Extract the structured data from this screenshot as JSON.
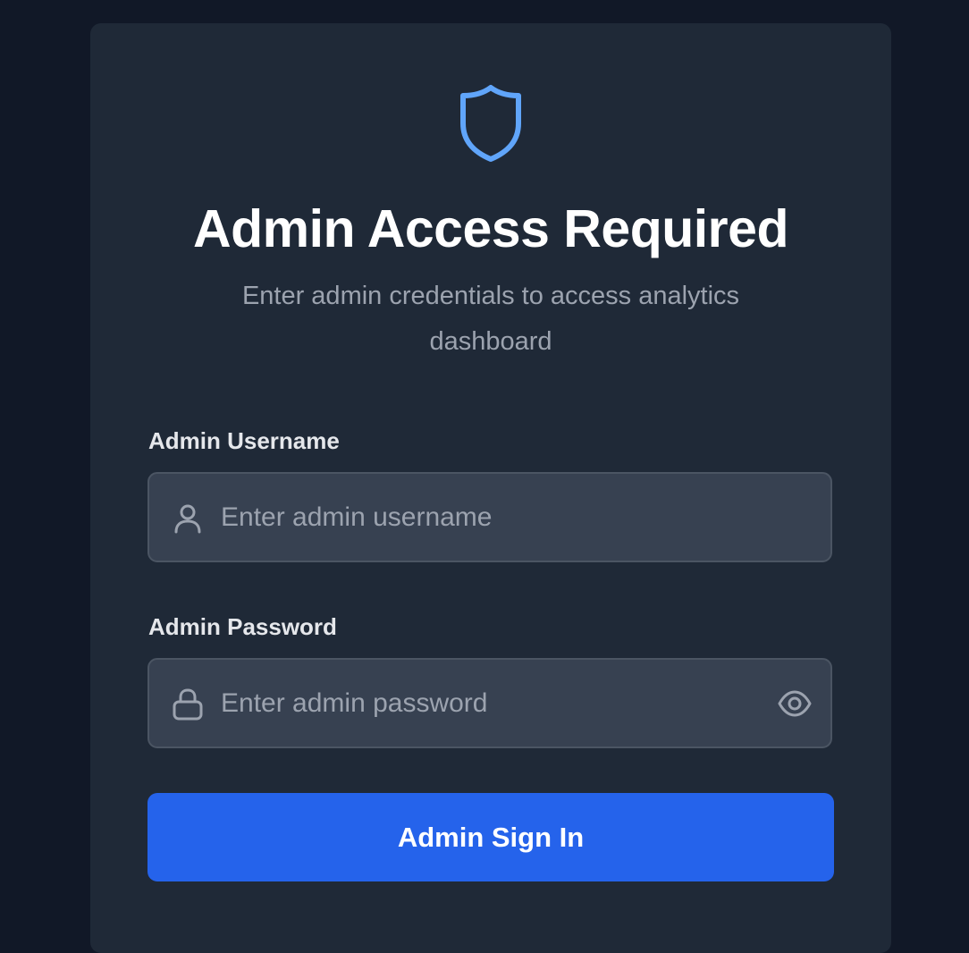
{
  "header": {
    "icon": "shield-icon",
    "title": "Admin Access Required",
    "subtitle": "Enter admin credentials to access analytics dashboard"
  },
  "username": {
    "label": "Admin Username",
    "placeholder": "Enter admin username",
    "value": "",
    "icon": "user-icon"
  },
  "password": {
    "label": "Admin Password",
    "placeholder": "Enter admin password",
    "value": "",
    "icon": "lock-icon",
    "toggle_icon": "eye-icon"
  },
  "submit": {
    "label": "Admin Sign In"
  },
  "colors": {
    "background": "#111827",
    "card": "#1f2937",
    "input": "#374151",
    "accent": "#2563eb",
    "shield": "#60a5fa"
  }
}
